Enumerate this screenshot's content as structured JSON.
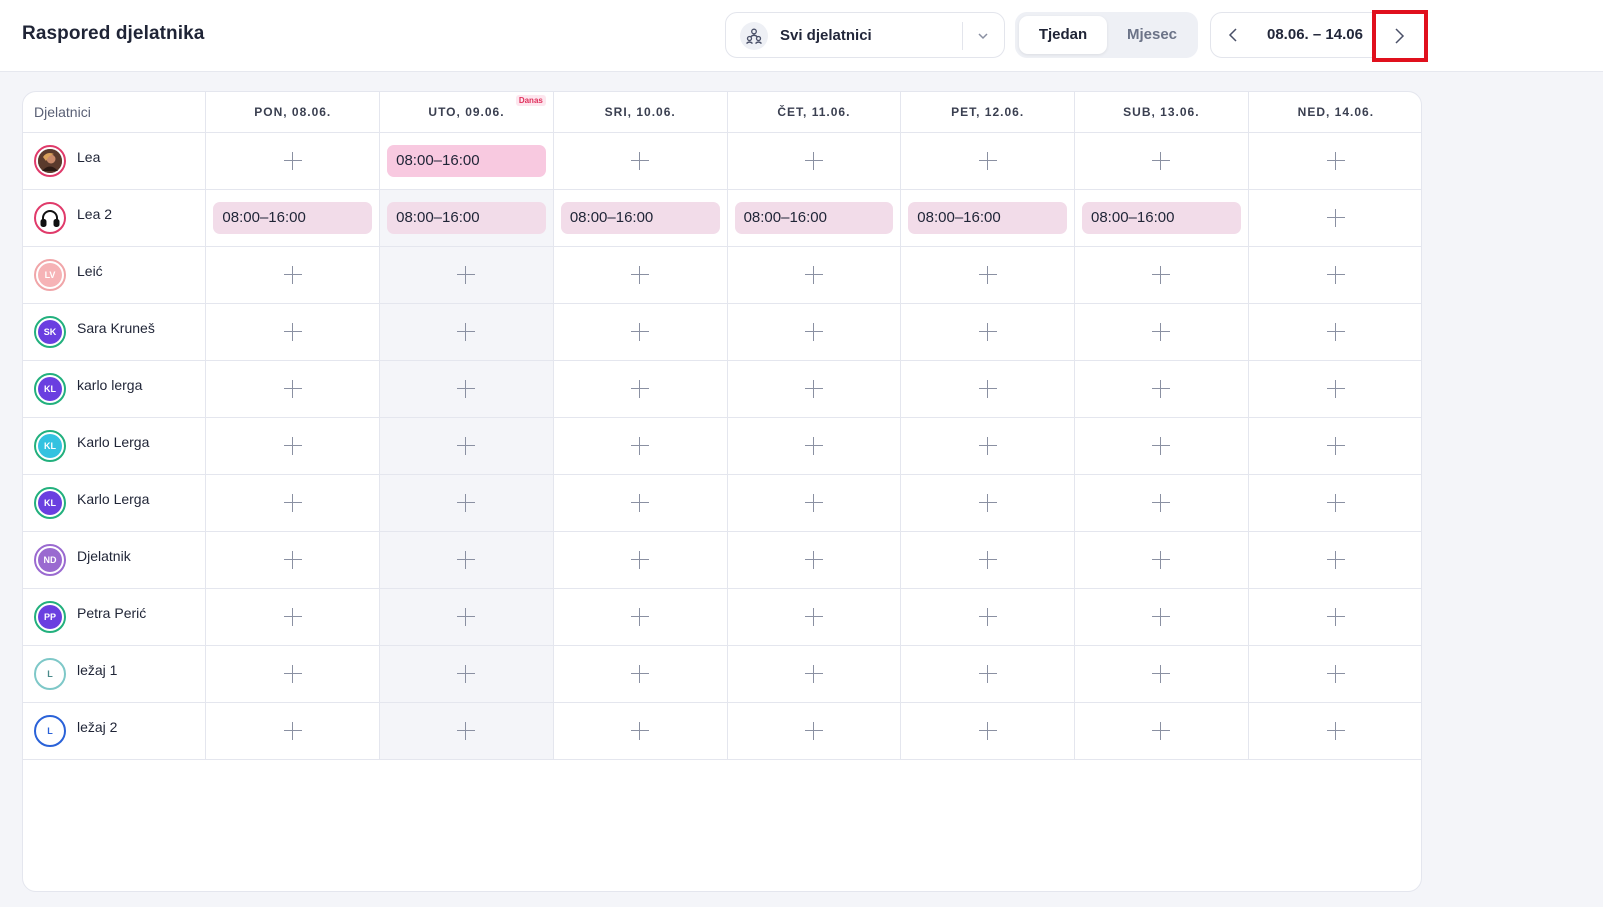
{
  "header": {
    "title": "Raspored djelatnika",
    "staff_filter": "Svi djelatnici",
    "view_tabs": {
      "week": "Tjedan",
      "month": "Mjesec"
    },
    "date_range": "08.06. – 14.06"
  },
  "schedule": {
    "corner_label": "Djelatnici",
    "today_badge": "Danas",
    "days": [
      "PON, 08.06.",
      "UTO, 09.06.",
      "SRI, 10.06.",
      "ČET, 11.06.",
      "PET, 12.06.",
      "SUB, 13.06.",
      "NED, 14.06."
    ],
    "employees": [
      {
        "name": "Lea",
        "initials": "",
        "avatar": "photo",
        "shifts": [
          "",
          "08:00–16:00",
          "",
          "",
          "",
          "",
          ""
        ]
      },
      {
        "name": "Lea 2",
        "initials": "",
        "avatar": "headphones",
        "shifts": [
          "08:00–16:00",
          "08:00–16:00",
          "08:00–16:00",
          "08:00–16:00",
          "08:00–16:00",
          "08:00–16:00",
          ""
        ]
      },
      {
        "name": "Leić",
        "initials": "LV",
        "avatar": "initials",
        "shifts": [
          "",
          "",
          "",
          "",
          "",
          "",
          ""
        ]
      },
      {
        "name": "Sara Kruneš",
        "initials": "SK",
        "avatar": "initials",
        "shifts": [
          "",
          "",
          "",
          "",
          "",
          "",
          ""
        ]
      },
      {
        "name": "karlo lerga",
        "initials": "KL",
        "avatar": "initials",
        "shifts": [
          "",
          "",
          "",
          "",
          "",
          "",
          ""
        ]
      },
      {
        "name": "Karlo Lerga",
        "initials": "KL",
        "avatar": "initials",
        "shifts": [
          "",
          "",
          "",
          "",
          "",
          "",
          ""
        ]
      },
      {
        "name": "Karlo Lerga",
        "initials": "KL",
        "avatar": "initials",
        "shifts": [
          "",
          "",
          "",
          "",
          "",
          "",
          ""
        ]
      },
      {
        "name": "Djelatnik",
        "initials": "ND",
        "avatar": "initials",
        "shifts": [
          "",
          "",
          "",
          "",
          "",
          "",
          ""
        ]
      },
      {
        "name": "Petra Perić",
        "initials": "PP",
        "avatar": "initials",
        "shifts": [
          "",
          "",
          "",
          "",
          "",
          "",
          ""
        ]
      },
      {
        "name": "ležaj 1",
        "initials": "L",
        "avatar": "initials",
        "shifts": [
          "",
          "",
          "",
          "",
          "",
          "",
          ""
        ]
      },
      {
        "name": "ležaj 2",
        "initials": "L",
        "avatar": "initials",
        "shifts": [
          "",
          "",
          "",
          "",
          "",
          "",
          ""
        ]
      }
    ]
  },
  "colors": {
    "shift_bg": "#f2dce9",
    "shift_bg_today": "#f8c9e0",
    "highlight_box": "#e0101d"
  }
}
